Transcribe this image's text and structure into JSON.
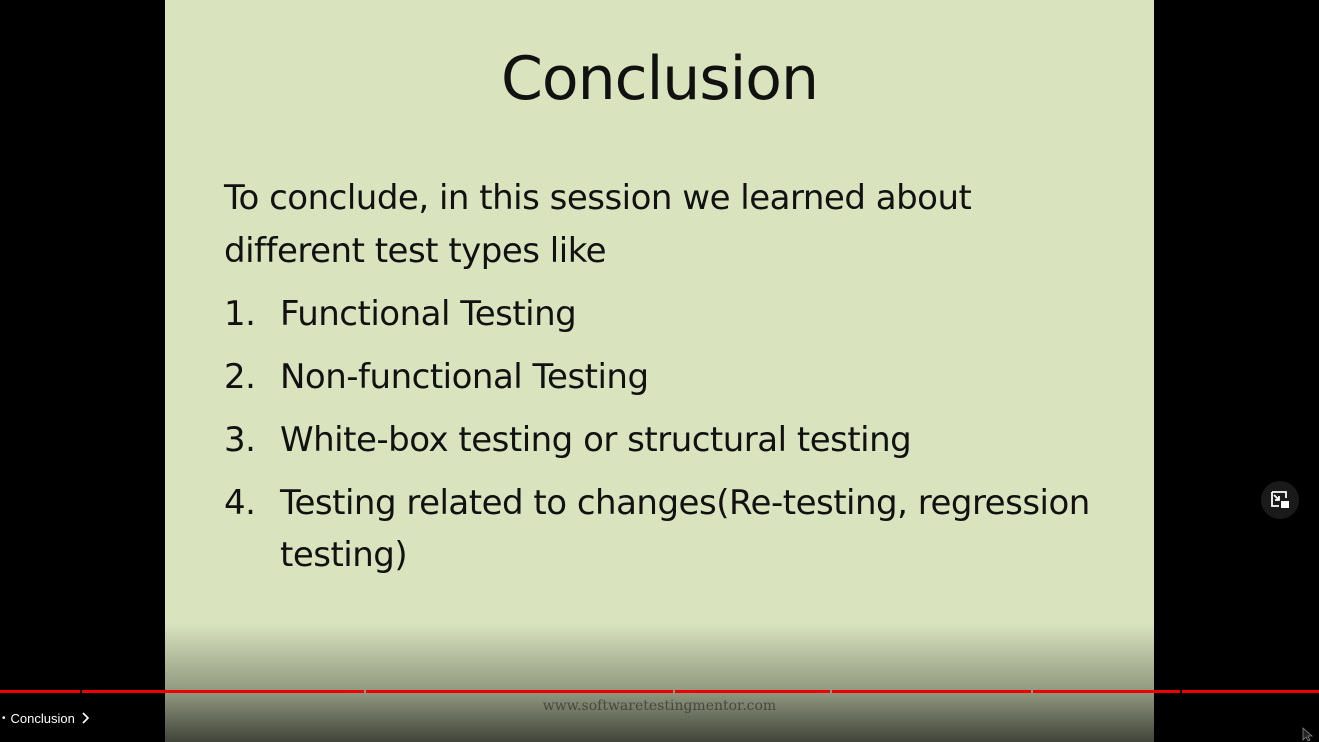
{
  "slide": {
    "title": "Conclusion",
    "intro": "To conclude, in this session we learned about different test types like",
    "items": [
      {
        "num": "1.",
        "text": "Functional Testing"
      },
      {
        "num": "2.",
        "text": "Non-functional Testing"
      },
      {
        "num": "3.",
        "text": "White-box testing or structural testing"
      },
      {
        "num": "4.",
        "text": "Testing related to changes(Re-testing, regression testing)"
      }
    ],
    "footer_url": "www.softwaretestingmentor.com"
  },
  "player": {
    "chapter_label": "Conclusion",
    "chapter_prefix": "•",
    "progress_fraction": 1.0,
    "progress_color": "#ee0000",
    "miniplayer_icon": "miniplayer-icon"
  },
  "colors": {
    "slide_background": "#d9e4bf",
    "player_background": "#000000"
  }
}
